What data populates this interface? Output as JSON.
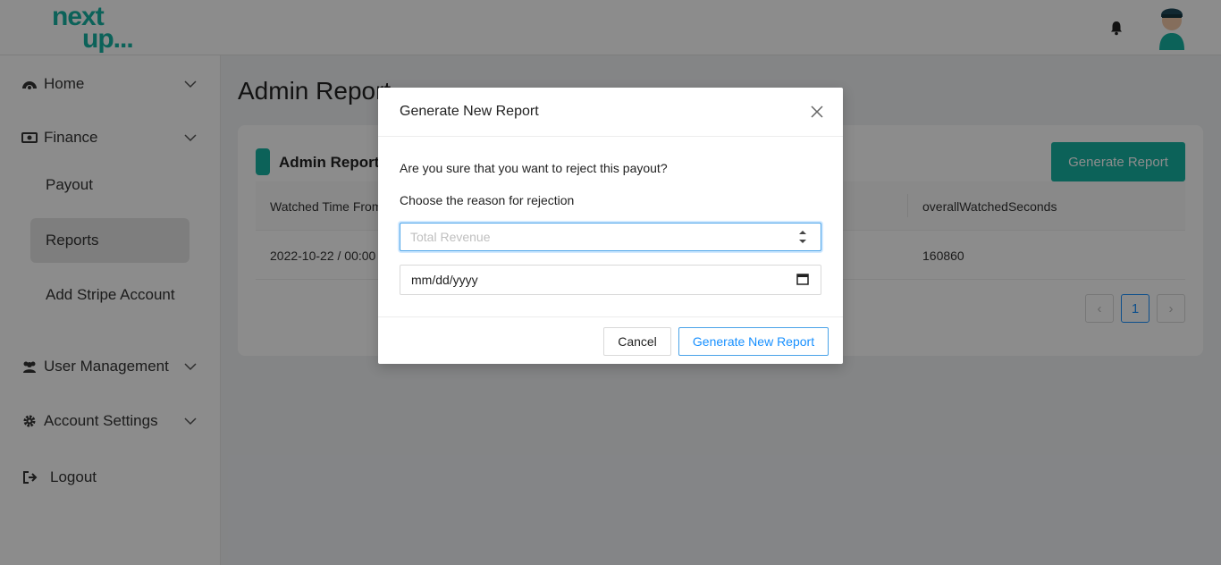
{
  "brand": {
    "logo_line1": "next",
    "logo_line2": "up...",
    "accent": "#17b3a3"
  },
  "header": {
    "bell_icon": "bell-icon",
    "avatar_icon": "user-avatar"
  },
  "sidebar": {
    "home": {
      "label": "Home",
      "icon": "dashboard-icon"
    },
    "finance": {
      "label": "Finance",
      "icon": "money-icon"
    },
    "finance_items": [
      {
        "label": "Payout",
        "active": false
      },
      {
        "label": "Reports",
        "active": true
      },
      {
        "label": "Add Stripe Account",
        "active": false
      }
    ],
    "user_management": {
      "label": "User Management",
      "icon": "users-icon"
    },
    "account_settings": {
      "label": "Account Settings",
      "icon": "gear-icon"
    },
    "logout": {
      "label": "Logout",
      "icon": "logout-icon"
    }
  },
  "page": {
    "title": "Admin Report",
    "card_title": "Admin Report",
    "generate_button": "Generate Report",
    "table": {
      "columns": [
        "Watched Time From",
        "overallWatchedSeconds"
      ],
      "rows": [
        [
          "2022-10-22 / 00:00",
          "160860"
        ]
      ]
    },
    "pagination": {
      "current": "1",
      "prev": "‹",
      "next": "›"
    }
  },
  "modal": {
    "title": "Generate New Report",
    "question": "Are you sure that you want to reject this payout?",
    "reason_label": "Choose the reason for rejection",
    "revenue_placeholder": "Total Revenue",
    "date_placeholder": "mm/dd/yyyy",
    "cancel_label": "Cancel",
    "submit_label": "Generate New Report"
  }
}
